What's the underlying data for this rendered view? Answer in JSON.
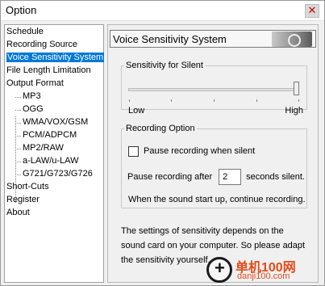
{
  "window": {
    "title": "Option",
    "close_glyph": "✕"
  },
  "tree": {
    "items": [
      {
        "label": "Schedule",
        "child": false,
        "selected": false
      },
      {
        "label": "Recording Source",
        "child": false,
        "selected": false
      },
      {
        "label": "Voice Sensitivity System",
        "child": false,
        "selected": true
      },
      {
        "label": "File Length Limitation",
        "child": false,
        "selected": false
      },
      {
        "label": "Output Format",
        "child": false,
        "selected": false
      },
      {
        "label": "MP3",
        "child": true,
        "selected": false
      },
      {
        "label": "OGG",
        "child": true,
        "selected": false
      },
      {
        "label": "WMA/VOX/GSM",
        "child": true,
        "selected": false
      },
      {
        "label": "PCM/ADPCM",
        "child": true,
        "selected": false
      },
      {
        "label": "MP2/RAW",
        "child": true,
        "selected": false
      },
      {
        "label": "a-LAW/u-LAW",
        "child": true,
        "selected": false
      },
      {
        "label": "G721/G723/G726",
        "child": true,
        "selected": false
      },
      {
        "label": "Short-Cuts",
        "child": false,
        "selected": false
      },
      {
        "label": "Register",
        "child": false,
        "selected": false
      },
      {
        "label": "About",
        "child": false,
        "selected": false
      }
    ]
  },
  "panel": {
    "title": "Voice Sensitivity System",
    "logo_icon": "disc-logo-icon",
    "sensitivity": {
      "legend": "Sensitivity for Silent",
      "low_label": "Low",
      "high_label": "High",
      "value_fraction": 1.0
    },
    "recording_option": {
      "legend": "Recording Option",
      "pause_when_silent_label": "Pause recording when silent",
      "pause_when_silent_checked": false,
      "pause_after_prefix": "Pause recording after",
      "pause_after_value": "2",
      "pause_after_suffix": "seconds silent.",
      "continue_text": "When the sound start up, continue recording."
    },
    "info_text": "The settings of sensitivity depends on the sound card on your computer. So please adapt the sensitivity yourself."
  },
  "watermark": {
    "text_main": "单机100网",
    "text_url": "danji100.com",
    "icon": "plus-circle-icon"
  }
}
